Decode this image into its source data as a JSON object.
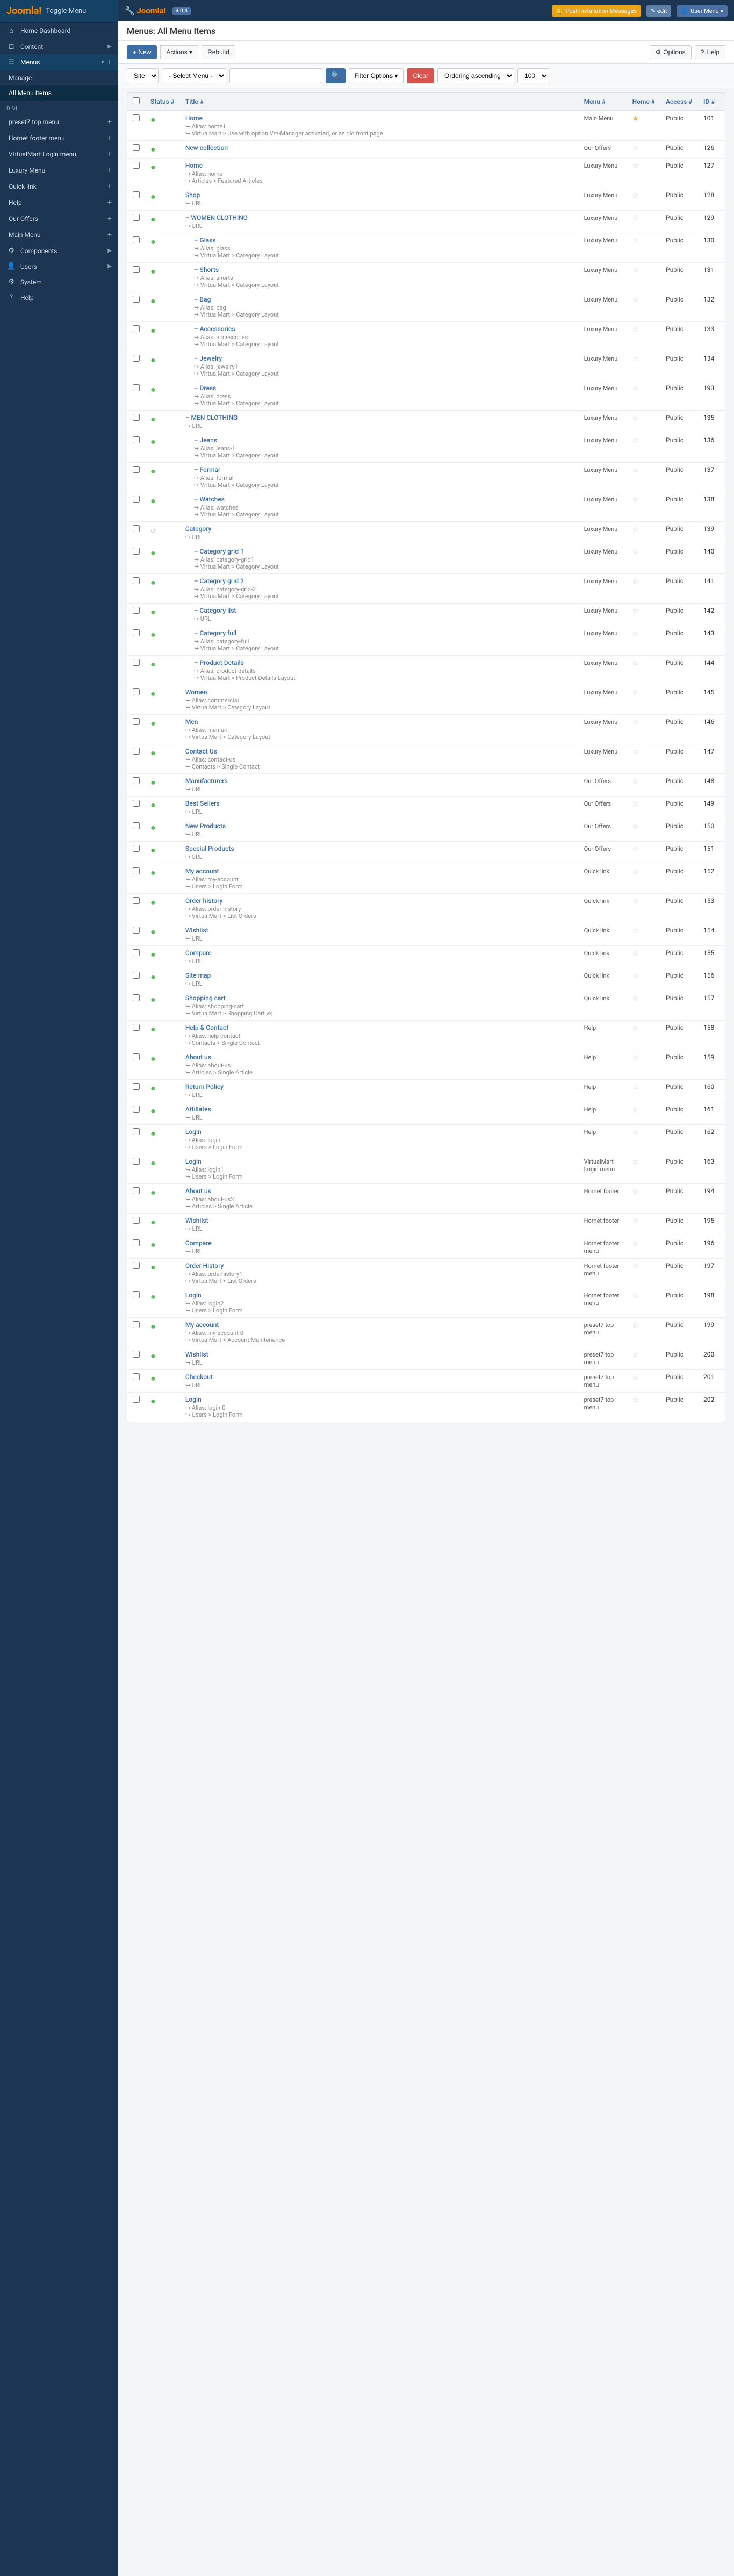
{
  "topbar": {
    "logo": "Joomla!",
    "toggle_menu": "Toggle Menu",
    "version": "4.0.4",
    "install_msg": "Post Installation Messages",
    "edit_label": "edit",
    "user_menu": "User Menu ▾"
  },
  "page": {
    "title": "Menus: All Menu Items"
  },
  "toolbar": {
    "new": "+ New",
    "actions": "Actions ▾",
    "rebuild": "Rebuild",
    "options": "Options",
    "help": "Help"
  },
  "filters": {
    "site_label": "Site",
    "select_menu_placeholder": "- Select Menu -",
    "search_placeholder": "",
    "filter_options": "Filter Options ▾",
    "clear": "Clear",
    "ordering": "Ordering ascending",
    "count": "100"
  },
  "table": {
    "headers": {
      "status": "Status #",
      "title": "Title #",
      "menu": "Menu #",
      "home": "Home #",
      "access": "Access #",
      "id": "ID #"
    },
    "rows": [
      {
        "id": 101,
        "status": "green",
        "title": "Home",
        "indent": 0,
        "alias": "Alias: home1",
        "note": "VirtualMart > Use with option Vm-Manager activated, or as old front page",
        "deprecated": true,
        "menu": "Main Menu",
        "home": true,
        "access": "Public"
      },
      {
        "id": 126,
        "status": "green",
        "title": "New collection",
        "indent": 0,
        "alias": "",
        "note": "",
        "deprecated": false,
        "menu": "Our Offers",
        "home": false,
        "access": "Public"
      },
      {
        "id": 127,
        "status": "green",
        "title": "Home",
        "indent": 0,
        "alias": "Alias: home",
        "note": "Articles > Featured Articles",
        "deprecated": false,
        "menu": "Luxury Menu",
        "home": false,
        "access": "Public"
      },
      {
        "id": 128,
        "status": "green",
        "title": "Shop",
        "indent": 0,
        "alias": "URL",
        "note": "",
        "deprecated": false,
        "menu": "Luxury Menu",
        "home": false,
        "access": "Public"
      },
      {
        "id": 129,
        "status": "green",
        "title": "– WOMEN CLOTHING",
        "indent": 0,
        "alias": "URL",
        "note": "",
        "deprecated": false,
        "menu": "Luxury Menu",
        "home": false,
        "access": "Public"
      },
      {
        "id": 130,
        "status": "green",
        "title": "– Glass",
        "indent": 1,
        "alias": "Alias: glass",
        "note": "VirtualMart > Category Layout",
        "deprecated": false,
        "menu": "Luxury Menu",
        "home": false,
        "access": "Public"
      },
      {
        "id": 131,
        "status": "green",
        "title": "– Shorts",
        "indent": 1,
        "alias": "Alias: shorts",
        "note": "VirtualMart > Category Layout",
        "deprecated": false,
        "menu": "Luxury Menu",
        "home": false,
        "access": "Public"
      },
      {
        "id": 132,
        "status": "green",
        "title": "– Bag",
        "indent": 1,
        "alias": "Alias: bag",
        "note": "VirtualMart > Category Layout",
        "deprecated": false,
        "menu": "Luxury Menu",
        "home": false,
        "access": "Public"
      },
      {
        "id": 133,
        "status": "green",
        "title": "– Accessories",
        "indent": 1,
        "alias": "Alias: accessories",
        "note": "VirtualMart > Category Layout",
        "deprecated": false,
        "menu": "Luxury Menu",
        "home": false,
        "access": "Public"
      },
      {
        "id": 134,
        "status": "green",
        "title": "– Jewelry",
        "indent": 1,
        "alias": "Alias: jewelry1",
        "note": "VirtualMart > Category Layout",
        "deprecated": false,
        "menu": "Luxury Menu",
        "home": false,
        "access": "Public"
      },
      {
        "id": 193,
        "status": "green",
        "title": "– Dress",
        "indent": 1,
        "alias": "Alias: dress",
        "note": "VirtualMart > Category Layout",
        "deprecated": false,
        "menu": "Luxury Menu",
        "home": false,
        "access": "Public"
      },
      {
        "id": 135,
        "status": "green",
        "title": "– MEN CLOTHING",
        "indent": 0,
        "alias": "URL",
        "note": "",
        "deprecated": false,
        "menu": "Luxury Menu",
        "home": false,
        "access": "Public"
      },
      {
        "id": 136,
        "status": "green",
        "title": "– Jeans",
        "indent": 1,
        "alias": "Alias: jeans-1",
        "note": "VirtualMart > Category Layout",
        "deprecated": false,
        "menu": "Luxury Menu",
        "home": false,
        "access": "Public"
      },
      {
        "id": 137,
        "status": "green",
        "title": "– Formal",
        "indent": 1,
        "alias": "Alias: formal",
        "note": "VirtualMart > Category Layout",
        "deprecated": false,
        "menu": "Luxury Menu",
        "home": false,
        "access": "Public"
      },
      {
        "id": 138,
        "status": "green",
        "title": "– Watches",
        "indent": 1,
        "alias": "Alias: watches",
        "note": "VirtualMart > Category Layout",
        "deprecated": false,
        "menu": "Luxury Menu",
        "home": false,
        "access": "Public"
      },
      {
        "id": 139,
        "status": "gray",
        "title": "Category",
        "indent": 0,
        "alias": "URL",
        "note": "",
        "deprecated": false,
        "menu": "Luxury Menu",
        "home": false,
        "access": "Public"
      },
      {
        "id": 140,
        "status": "green",
        "title": "– Category grid 1",
        "indent": 1,
        "alias": "Alias: category-grid1",
        "note": "VirtualMart > Category Layout",
        "deprecated": false,
        "menu": "Luxury Menu",
        "home": false,
        "access": "Public"
      },
      {
        "id": 141,
        "status": "green",
        "title": "– Category grid 2",
        "indent": 1,
        "alias": "Alias: category-grid-2",
        "note": "VirtualMart > Category Layout",
        "deprecated": false,
        "menu": "Luxury Menu",
        "home": false,
        "access": "Public"
      },
      {
        "id": 142,
        "status": "green",
        "title": "– Category list",
        "indent": 1,
        "alias": "URL",
        "note": "",
        "deprecated": false,
        "menu": "Luxury Menu",
        "home": false,
        "access": "Public"
      },
      {
        "id": 143,
        "status": "green",
        "title": "– Category full",
        "indent": 1,
        "alias": "Alias: category-full",
        "note": "VirtualMart > Category Layout",
        "deprecated": false,
        "menu": "Luxury Menu",
        "home": false,
        "access": "Public"
      },
      {
        "id": 144,
        "status": "green",
        "title": "– Product Details",
        "indent": 1,
        "alias": "Alias: product-details",
        "note": "VirtualMart > Product Details Layout",
        "deprecated": false,
        "menu": "Luxury Menu",
        "home": false,
        "access": "Public"
      },
      {
        "id": 145,
        "status": "green",
        "title": "Women",
        "indent": 0,
        "alias": "Alias: commercial",
        "note": "VirtualMart > Category Layout",
        "deprecated": false,
        "menu": "Luxury Menu",
        "home": false,
        "access": "Public"
      },
      {
        "id": 146,
        "status": "green",
        "title": "Men",
        "indent": 0,
        "alias": "Alias: men-url",
        "note": "VirtualMart > Category Layout",
        "deprecated": false,
        "menu": "Luxury Menu",
        "home": false,
        "access": "Public"
      },
      {
        "id": 147,
        "status": "green",
        "title": "Contact Us",
        "indent": 0,
        "alias": "Alias: contact-us",
        "note": "Contacts > Single Contact",
        "deprecated": false,
        "menu": "Luxury Menu",
        "home": false,
        "access": "Public"
      },
      {
        "id": 148,
        "status": "green",
        "title": "Manufacturers",
        "indent": 0,
        "alias": "URL",
        "note": "",
        "deprecated": false,
        "menu": "Our Offers",
        "home": false,
        "access": "Public"
      },
      {
        "id": 149,
        "status": "green",
        "title": "Best Sellers",
        "indent": 0,
        "alias": "URL",
        "note": "",
        "deprecated": false,
        "menu": "Our Offers",
        "home": false,
        "access": "Public"
      },
      {
        "id": 150,
        "status": "green",
        "title": "New Products",
        "indent": 0,
        "alias": "URL",
        "note": "",
        "deprecated": false,
        "menu": "Our Offers",
        "home": false,
        "access": "Public"
      },
      {
        "id": 151,
        "status": "green",
        "title": "Special Products",
        "indent": 0,
        "alias": "URL",
        "note": "",
        "deprecated": false,
        "menu": "Our Offers",
        "home": false,
        "access": "Public"
      },
      {
        "id": 152,
        "status": "green",
        "title": "My account",
        "indent": 0,
        "alias": "Alias: my-account",
        "note": "Users > Login Form",
        "deprecated": false,
        "menu": "Quick link",
        "home": false,
        "access": "Public"
      },
      {
        "id": 153,
        "status": "green",
        "title": "Order history",
        "indent": 0,
        "alias": "Alias: order-history",
        "note": "VirtualMart > List Orders",
        "deprecated": false,
        "menu": "Quick link",
        "home": false,
        "access": "Public"
      },
      {
        "id": 154,
        "status": "green",
        "title": "Wishlist",
        "indent": 0,
        "alias": "URL",
        "note": "",
        "deprecated": false,
        "menu": "Quick link",
        "home": false,
        "access": "Public"
      },
      {
        "id": 155,
        "status": "green",
        "title": "Compare",
        "indent": 0,
        "alias": "URL",
        "note": "",
        "deprecated": false,
        "menu": "Quick link",
        "home": false,
        "access": "Public"
      },
      {
        "id": 156,
        "status": "green",
        "title": "Site map",
        "indent": 0,
        "alias": "URL",
        "note": "",
        "deprecated": false,
        "menu": "Quick link",
        "home": false,
        "access": "Public"
      },
      {
        "id": 157,
        "status": "green",
        "title": "Shopping cart",
        "indent": 0,
        "alias": "Alias: shopping-cart",
        "note": "VirtualMart > Shopping Cart vk",
        "deprecated": false,
        "menu": "Quick link",
        "home": false,
        "access": "Public"
      },
      {
        "id": 158,
        "status": "green",
        "title": "Help & Contact",
        "indent": 0,
        "alias": "Alias: help-contact",
        "note": "Contacts > Single Contact",
        "deprecated": false,
        "menu": "Help",
        "home": false,
        "access": "Public"
      },
      {
        "id": 159,
        "status": "green",
        "title": "About us",
        "indent": 0,
        "alias": "Alias: about-us",
        "note": "Articles > Single Article",
        "deprecated": false,
        "menu": "Help",
        "home": false,
        "access": "Public"
      },
      {
        "id": 160,
        "status": "green",
        "title": "Return Policy",
        "indent": 0,
        "alias": "URL",
        "note": "",
        "deprecated": false,
        "menu": "Help",
        "home": false,
        "access": "Public"
      },
      {
        "id": 161,
        "status": "green",
        "title": "Affiliates",
        "indent": 0,
        "alias": "URL",
        "note": "",
        "deprecated": false,
        "menu": "Help",
        "home": false,
        "access": "Public"
      },
      {
        "id": 162,
        "status": "green",
        "title": "Login",
        "indent": 0,
        "alias": "Alias: login",
        "note": "Users > Login Form",
        "deprecated": false,
        "menu": "Help",
        "home": false,
        "access": "Public"
      },
      {
        "id": 163,
        "status": "green",
        "title": "Login",
        "indent": 0,
        "alias": "Alias: login1",
        "note": "Users > Login Form",
        "deprecated": false,
        "menu": "VirtualMart Login menu",
        "home": false,
        "access": "Public"
      },
      {
        "id": 194,
        "status": "green",
        "title": "About us",
        "indent": 0,
        "alias": "Alias: about-us2",
        "note": "Articles > Single Article",
        "deprecated": false,
        "menu": "Hornet footer",
        "home": false,
        "access": "Public"
      },
      {
        "id": 195,
        "status": "green",
        "title": "Wishlist",
        "indent": 0,
        "alias": "URL",
        "note": "",
        "deprecated": false,
        "menu": "Hornet footer",
        "home": false,
        "access": "Public"
      },
      {
        "id": 196,
        "status": "green",
        "title": "Compare",
        "indent": 0,
        "alias": "URL",
        "note": "",
        "deprecated": false,
        "menu": "Hornet footer menu",
        "home": false,
        "access": "Public"
      },
      {
        "id": 197,
        "status": "green",
        "title": "Order History",
        "indent": 0,
        "alias": "Alias: orderhistory1",
        "note": "VirtualMart > List Orders",
        "deprecated": false,
        "menu": "Hornet footer menu",
        "home": false,
        "access": "Public"
      },
      {
        "id": 198,
        "status": "green",
        "title": "Login",
        "indent": 0,
        "alias": "Alias: login2",
        "note": "Users > Login Form",
        "deprecated": false,
        "menu": "Hornet footer menu",
        "home": false,
        "access": "Public"
      },
      {
        "id": 199,
        "status": "green",
        "title": "My account",
        "indent": 0,
        "alias": "Alias: my-account-0",
        "note": "VirtualMart > Account Maintenance",
        "deprecated": false,
        "menu": "preset7 top menu",
        "home": false,
        "access": "Public"
      },
      {
        "id": 200,
        "status": "green",
        "title": "Wishlist",
        "indent": 0,
        "alias": "URL",
        "note": "",
        "deprecated": false,
        "menu": "preset7 top menu",
        "home": false,
        "access": "Public"
      },
      {
        "id": 201,
        "status": "green",
        "title": "Checkout",
        "indent": 0,
        "alias": "URL",
        "note": "",
        "deprecated": false,
        "menu": "preset7 top menu",
        "home": false,
        "access": "Public"
      },
      {
        "id": 202,
        "status": "green",
        "title": "Login",
        "indent": 0,
        "alias": "Alias: login-0",
        "note": "Users > Login Form",
        "deprecated": false,
        "menu": "preset7 top menu",
        "home": false,
        "access": "Public"
      }
    ]
  },
  "sidebar": {
    "toggle_menu": "Toggle Menu",
    "items": [
      {
        "label": "Home Dashboard",
        "icon": "⌂",
        "active": false
      },
      {
        "label": "Content",
        "icon": "📄",
        "active": false,
        "arrow": "▶"
      },
      {
        "label": "Menus",
        "icon": "☰",
        "active": true,
        "arrow": "▼"
      },
      {
        "label": "Manage",
        "sub": true
      },
      {
        "label": "All Menu Items",
        "sub": true,
        "active": true
      },
      {
        "label": "Divi",
        "section": true
      },
      {
        "label": "preset7 top menu",
        "sub": true
      },
      {
        "label": "Hornet footer menu",
        "sub": true
      },
      {
        "label": "VirtualMart Login menu",
        "sub": true
      },
      {
        "label": "Luxury Menu",
        "sub": true
      },
      {
        "label": "Quick link",
        "sub": true
      },
      {
        "label": "Help",
        "sub": true
      },
      {
        "label": "Our Offers",
        "sub": true
      },
      {
        "label": "Main Menu",
        "sub": true
      }
    ],
    "components": {
      "label": "Components",
      "arrow": "▶"
    },
    "users": {
      "label": "Users",
      "arrow": "▶"
    },
    "system": {
      "label": "System"
    },
    "help": {
      "label": "Help"
    }
  }
}
